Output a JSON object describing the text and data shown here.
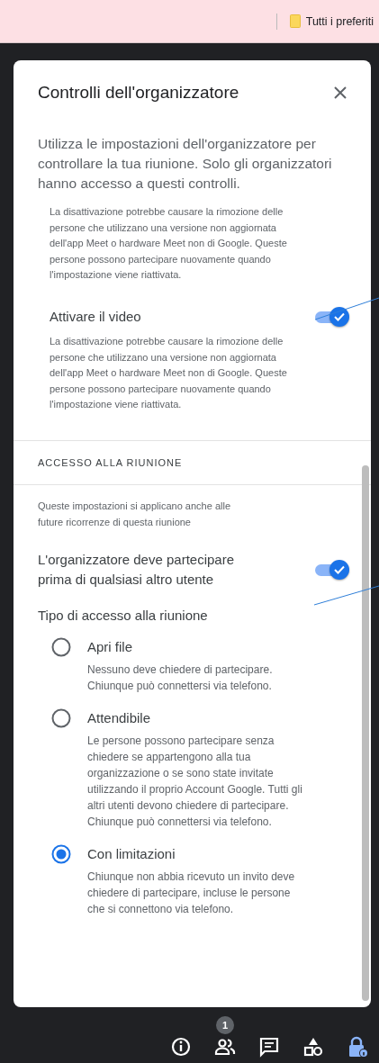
{
  "bookmarks_bar": {
    "label": "Tutti i preferiti"
  },
  "panel": {
    "title": "Controlli dell'organizzatore",
    "intro": "Utilizza le impostazioni dell'organizzatore per controllare la tua riunione. Solo gli organizzatori hanno accesso a questi controlli.",
    "top_note": "La disattivazione potrebbe causare la rimozione delle persone che utilizzano una versione non aggiornata dell'app Meet o hardware Meet non di Google. Queste persone possono partecipare nuovamente quando l'impostazione viene riattivata.",
    "settings": [
      {
        "label": "Attivare il video",
        "on": true,
        "description": "La disattivazione potrebbe causare la rimozione delle persone che utilizzano una versione non aggiornata dell'app Meet o hardware Meet non di Google. Queste persone possono partecipare nuovamente quando l'impostazione viene riattivata."
      }
    ],
    "access_section": {
      "heading": "ACCESSO ALLA RIUNIONE",
      "note": "Queste impostazioni si applicano anche alle future ricorrenze di questa riunione",
      "settings": [
        {
          "label": "L'organizzatore deve partecipare prima di qualsiasi altro utente",
          "on": true
        }
      ],
      "access_type_heading": "Tipo di accesso alla riunione",
      "options": [
        {
          "label": "Apri file",
          "description": "Nessuno deve chiedere di partecipare. Chiunque può connettersi via telefono.",
          "selected": false
        },
        {
          "label": "Attendibile",
          "description": "Le persone possono partecipare senza chiedere se appartengono alla tua organizzazione o se sono state invitate utilizzando il proprio Account Google. Tutti gli altri utenti devono chiedere di partecipare. Chiunque può connettersi via telefono.",
          "selected": false
        },
        {
          "label": "Con limitazioni",
          "description": "Chiunque non abbia ricevuto un invito deve chiedere di partecipare, incluse le persone che si connettono via telefono.",
          "selected": true
        }
      ]
    }
  },
  "toolbar": [
    {
      "kind": "info",
      "selected": false
    },
    {
      "kind": "people",
      "badge": "1",
      "selected": false
    },
    {
      "kind": "chat",
      "selected": false
    },
    {
      "kind": "activities",
      "selected": false
    },
    {
      "kind": "host-controls",
      "selected": true
    }
  ]
}
